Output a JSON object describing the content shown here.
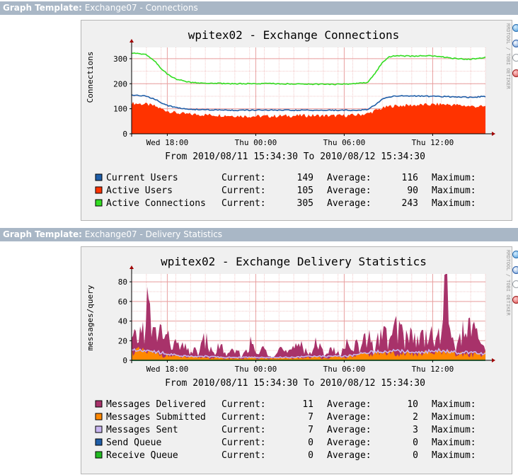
{
  "sections": [
    {
      "header_label": "Graph Template:",
      "header_value": "Exchange07 - Connections",
      "title": "wpitex02 - Exchange Connections",
      "ylabel": "Connections",
      "date_range": "From 2010/08/11 15:34:30 To 2010/08/12 15:34:30",
      "watermark": "RRDTOOL / TOBI OETIKER",
      "legend": [
        {
          "label": "Current Users",
          "color": "#1f5ea8",
          "current_label": "Current:",
          "current": "149",
          "average_label": "Average:",
          "average": "116",
          "maximum_label": "Maximum:"
        },
        {
          "label": "Active Users",
          "color": "#ff3300",
          "current_label": "Current:",
          "current": "105",
          "average_label": "Average:",
          "average": "90",
          "maximum_label": "Maximum:"
        },
        {
          "label": "Active Connections",
          "color": "#33dd22",
          "current_label": "Current:",
          "current": "305",
          "average_label": "Average:",
          "average": "243",
          "maximum_label": "Maximum:"
        }
      ]
    },
    {
      "header_label": "Graph Template:",
      "header_value": "Exchange07 - Delivery Statistics",
      "title": "wpitex02 - Exchange Delivery Statistics",
      "ylabel": "messages/query",
      "date_range": "From 2010/08/11 15:34:30 To 2010/08/12 15:34:30",
      "watermark": "RRDTOOL / TOBI OETIKER",
      "legend": [
        {
          "label": "Messages Delivered",
          "color": "#a8326a",
          "current_label": "Current:",
          "current": "11",
          "average_label": "Average:",
          "average": "10",
          "maximum_label": "Maximum:"
        },
        {
          "label": "Messages Submitted",
          "color": "#ff8800",
          "current_label": "Current:",
          "current": "7",
          "average_label": "Average:",
          "average": "2",
          "maximum_label": "Maximum:"
        },
        {
          "label": "Messages Sent",
          "color": "#c8b6f0",
          "current_label": "Current:",
          "current": "7",
          "average_label": "Average:",
          "average": "3",
          "maximum_label": "Maximum:"
        },
        {
          "label": "Send Queue",
          "color": "#1f5ea8",
          "current_label": "Current:",
          "current": "0",
          "average_label": "Average:",
          "average": "0",
          "maximum_label": "Maximum:"
        },
        {
          "label": "Receive Queue",
          "color": "#22bb22",
          "current_label": "Current:",
          "current": "0",
          "average_label": "Average:",
          "average": "0",
          "maximum_label": "Maximum:"
        }
      ]
    }
  ],
  "side_icons": [
    "zoom-icon",
    "info-icon",
    "checkbox-icon",
    "delete-icon"
  ],
  "chart_data": [
    {
      "type": "area",
      "title": "wpitex02 - Exchange Connections",
      "xlabel": "",
      "ylabel": "Connections",
      "x_ticks": [
        "Wed 18:00",
        "Thu 00:00",
        "Thu 06:00",
        "Thu 12:00"
      ],
      "x_tick_hours": [
        2.42,
        8.42,
        14.42,
        20.42
      ],
      "x_range_hours": [
        0,
        24
      ],
      "y_ticks": [
        0,
        100,
        200,
        300
      ],
      "ylim": [
        0,
        345
      ],
      "grid": true,
      "legend_position": "bottom",
      "series": [
        {
          "name": "Active Users",
          "style": "area",
          "color": "#ff3300",
          "x": [
            0,
            0.5,
            1,
            1.5,
            2,
            2.5,
            3,
            3.5,
            4,
            5,
            6,
            7,
            8,
            9,
            10,
            11,
            12,
            13,
            14,
            15,
            16,
            16.5,
            17,
            17.5,
            18,
            19,
            20,
            21,
            22,
            23,
            24
          ],
          "values": [
            122,
            120,
            118,
            112,
            100,
            90,
            84,
            80,
            78,
            76,
            74,
            72,
            70,
            70,
            71,
            72,
            73,
            72,
            72,
            74,
            80,
            92,
            102,
            110,
            112,
            114,
            116,
            118,
            115,
            110,
            108
          ]
        },
        {
          "name": "Current Users",
          "style": "line",
          "color": "#1f5ea8",
          "x": [
            0,
            0.5,
            1,
            1.5,
            2,
            2.5,
            3,
            3.5,
            4,
            5,
            6,
            7,
            8,
            9,
            10,
            11,
            12,
            13,
            14,
            15,
            16,
            16.5,
            17,
            17.5,
            18,
            19,
            20,
            21,
            22,
            23,
            24
          ],
          "values": [
            155,
            153,
            150,
            140,
            125,
            112,
            105,
            100,
            98,
            96,
            95,
            94,
            94,
            95,
            94,
            94,
            94,
            94,
            94,
            94,
            96,
            115,
            138,
            148,
            152,
            151,
            150,
            149,
            147,
            146,
            149
          ]
        },
        {
          "name": "Active Connections",
          "style": "line",
          "color": "#33dd22",
          "x": [
            0,
            0.5,
            1,
            1.5,
            2,
            2.5,
            3,
            3.5,
            4,
            5,
            6,
            7,
            8,
            9,
            10,
            11,
            12,
            13,
            14,
            15,
            16,
            16.5,
            17,
            17.5,
            18,
            19,
            20,
            21,
            22,
            23,
            24
          ],
          "values": [
            322,
            320,
            316,
            295,
            260,
            235,
            218,
            212,
            205,
            202,
            201,
            200,
            200,
            201,
            200,
            199,
            198,
            198,
            198,
            199,
            205,
            240,
            285,
            308,
            312,
            310,
            312,
            308,
            300,
            298,
            305
          ]
        }
      ]
    },
    {
      "type": "area",
      "title": "wpitex02 - Exchange Delivery Statistics",
      "xlabel": "",
      "ylabel": "messages/query",
      "x_ticks": [
        "Wed 18:00",
        "Thu 00:00",
        "Thu 06:00",
        "Thu 12:00"
      ],
      "x_tick_hours": [
        2.42,
        8.42,
        14.42,
        20.42
      ],
      "x_range_hours": [
        0,
        24
      ],
      "y_ticks": [
        0,
        20,
        40,
        60,
        80
      ],
      "ylim": [
        0,
        88
      ],
      "grid": true,
      "legend_position": "bottom",
      "series": [
        {
          "name": "Messages Delivered",
          "style": "area",
          "color": "#a8326a",
          "x": [
            0,
            0.5,
            0.9,
            1.1,
            1.4,
            2.0,
            2.5,
            3.0,
            3.5,
            4.0,
            4.5,
            5.0,
            5.5,
            6.0,
            6.5,
            7.0,
            7.5,
            8.0,
            8.5,
            9.0,
            9.5,
            10.0,
            10.5,
            11.0,
            11.5,
            12.0,
            12.5,
            13.0,
            13.5,
            14.0,
            14.5,
            15.0,
            15.5,
            16.0,
            16.5,
            17.0,
            17.5,
            18.0,
            18.5,
            19.0,
            19.5,
            20.0,
            20.5,
            21.0,
            21.3,
            21.6,
            22.0,
            22.5,
            23.0,
            23.5,
            24.0
          ],
          "values": [
            18,
            25,
            35,
            60,
            25,
            30,
            20,
            15,
            12,
            10,
            8,
            22,
            6,
            15,
            5,
            10,
            4,
            18,
            6,
            12,
            5,
            14,
            7,
            10,
            20,
            6,
            16,
            8,
            12,
            6,
            14,
            20,
            10,
            25,
            12,
            30,
            18,
            35,
            22,
            28,
            18,
            32,
            20,
            25,
            82,
            30,
            15,
            28,
            35,
            20,
            12
          ]
        },
        {
          "name": "Messages Submitted",
          "style": "area",
          "color": "#ff8800",
          "x": [
            0,
            1,
            2,
            3,
            4,
            5,
            6,
            7,
            8,
            9,
            10,
            11,
            12,
            13,
            14,
            15,
            16,
            17,
            18,
            19,
            20,
            21,
            22,
            23,
            24
          ],
          "values": [
            10,
            8,
            6,
            4,
            3,
            3,
            2,
            2,
            2,
            2,
            2,
            2,
            3,
            3,
            3,
            4,
            6,
            7,
            8,
            6,
            7,
            8,
            6,
            6,
            7
          ]
        },
        {
          "name": "Messages Sent",
          "style": "line",
          "color": "#c8b6f0",
          "x": [
            0,
            1,
            2,
            3,
            4,
            5,
            6,
            7,
            8,
            9,
            10,
            11,
            12,
            13,
            14,
            15,
            16,
            17,
            18,
            19,
            20,
            21,
            22,
            23,
            24
          ],
          "values": [
            12,
            10,
            8,
            5,
            4,
            4,
            3,
            3,
            3,
            3,
            3,
            3,
            4,
            4,
            4,
            5,
            8,
            9,
            10,
            8,
            9,
            10,
            8,
            8,
            7
          ]
        },
        {
          "name": "Send Queue",
          "style": "line",
          "color": "#1f5ea8",
          "x": [
            0,
            24
          ],
          "values": [
            0,
            0
          ]
        },
        {
          "name": "Receive Queue",
          "style": "line",
          "color": "#22bb22",
          "x": [
            0,
            24
          ],
          "values": [
            0,
            0
          ]
        }
      ]
    }
  ]
}
